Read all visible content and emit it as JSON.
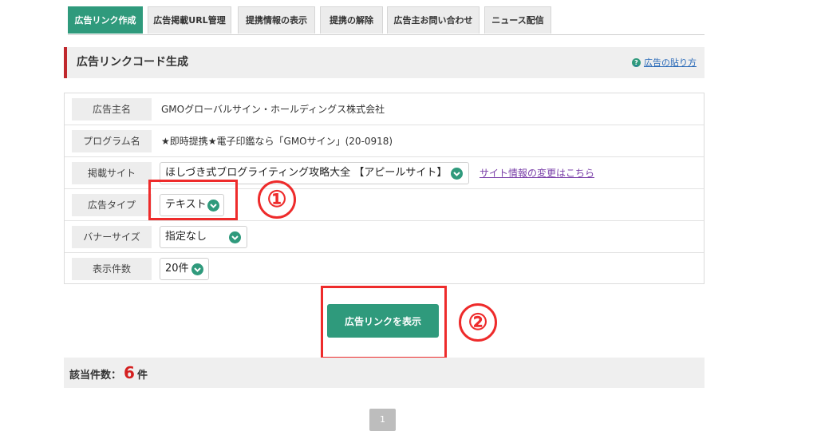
{
  "tabs": [
    {
      "label": "広告リンク作成",
      "active": true
    },
    {
      "label": "広告掲載URL管理",
      "active": false
    },
    {
      "label": "提携情報の表示",
      "active": false
    },
    {
      "label": "提携の解除",
      "active": false
    },
    {
      "label": "広告主お問い合わせ",
      "active": false
    },
    {
      "label": "ニュース配信",
      "active": false
    }
  ],
  "section": {
    "title": "広告リンクコード生成",
    "help_icon": "question-icon",
    "help_link": "広告の貼り方"
  },
  "form": {
    "advertiser": {
      "label": "広告主名",
      "value": "GMOグローバルサイン・ホールディングス株式会社"
    },
    "program": {
      "label": "プログラム名",
      "value": "★即時提携★電子印鑑なら「GMOサイン」(20-0918)"
    },
    "site": {
      "label": "掲載サイト",
      "selected": "ほしづき式ブログライティング攻略大全 【アピールサイト】",
      "change_link": "サイト情報の変更はこちら"
    },
    "ad_type": {
      "label": "広告タイプ",
      "selected": "テキスト"
    },
    "banner_size": {
      "label": "バナーサイズ",
      "selected": "指定なし"
    },
    "display_count": {
      "label": "表示件数",
      "selected": "20件"
    }
  },
  "annotations": {
    "step1": "①",
    "step2": "②"
  },
  "show_button": "広告リンクを表示",
  "results": {
    "label": "該当件数：",
    "count": "6",
    "unit": "件"
  },
  "pagination": {
    "current_page": "1"
  },
  "colors": {
    "accent": "#2f9a7c",
    "section_marker": "#c0282d",
    "annotation": "#ee2b2b",
    "count": "#d42020"
  }
}
